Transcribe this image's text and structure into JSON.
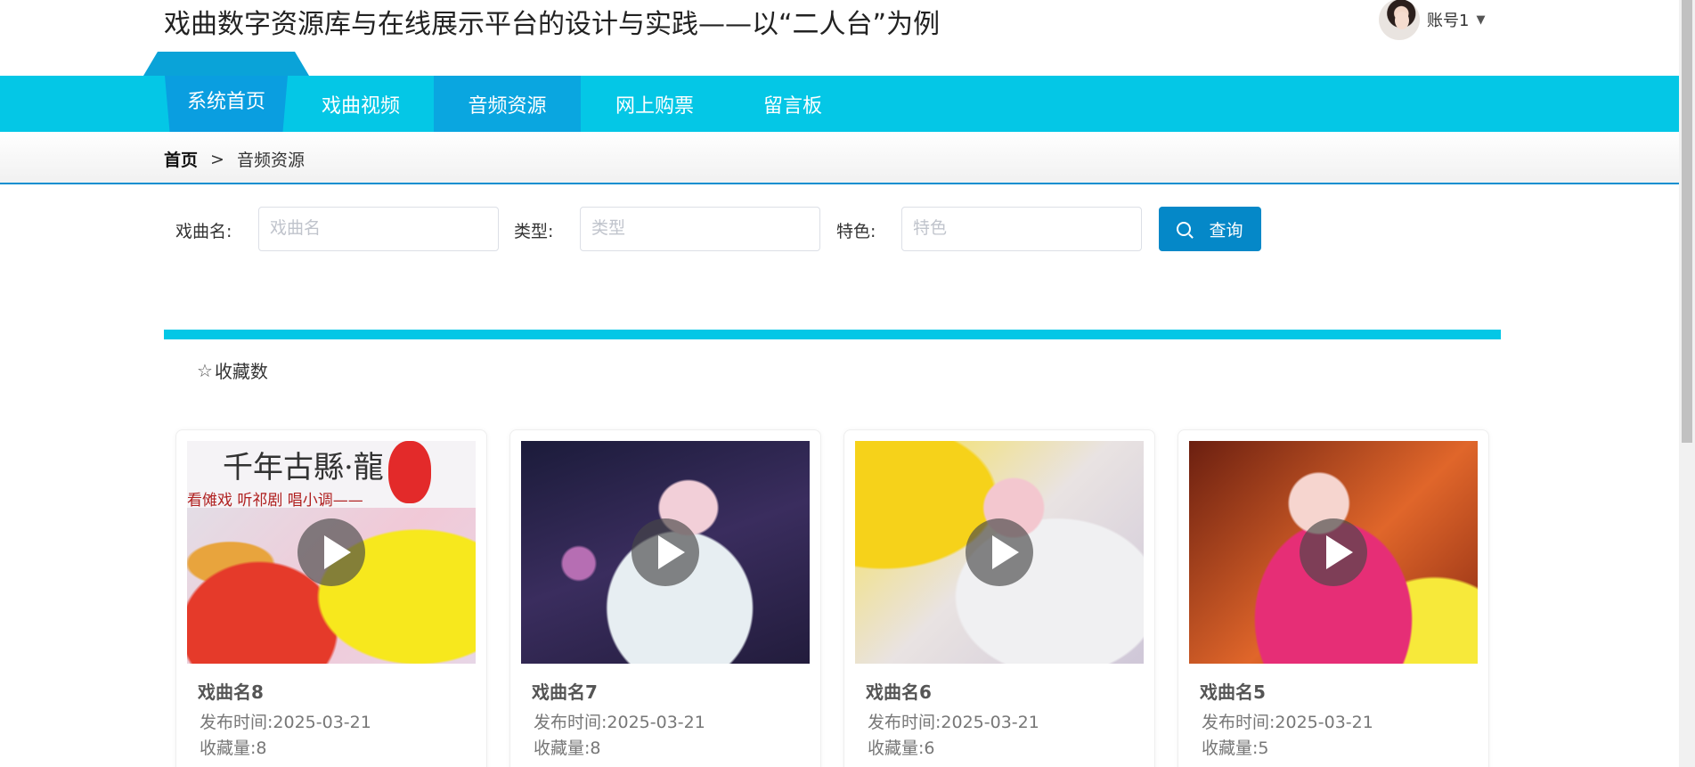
{
  "header": {
    "title": "戏曲数字资源库与在线展示平台的设计与实践——以“二人台”为例",
    "account_name": "账号1"
  },
  "nav": {
    "items": [
      {
        "label": "系统首页"
      },
      {
        "label": "戏曲视频"
      },
      {
        "label": "音频资源"
      },
      {
        "label": "网上购票"
      },
      {
        "label": "留言板"
      }
    ],
    "active": "音频资源"
  },
  "breadcrumb": {
    "home": "首页",
    "separator": ">",
    "current": "音频资源"
  },
  "search": {
    "name_label": "戏曲名:",
    "name_placeholder": "戏曲名",
    "type_label": "类型:",
    "type_placeholder": "类型",
    "feature_label": "特色:",
    "feature_placeholder": "特色",
    "button_label": "查询"
  },
  "sort": {
    "favorites_label": "收藏数"
  },
  "cards": [
    {
      "name": "戏曲名8",
      "publish": "发布时间:2025-03-21",
      "favorites": "收藏量:8"
    },
    {
      "name": "戏曲名7",
      "publish": "发布时间:2025-03-21",
      "favorites": "收藏量:8"
    },
    {
      "name": "戏曲名6",
      "publish": "发布时间:2025-03-21",
      "favorites": "收藏量:6"
    },
    {
      "name": "戏曲名5",
      "publish": "发布时间:2025-03-21",
      "favorites": "收藏量:5"
    }
  ],
  "thumb8_text": {
    "line1": "千年古縣·龍",
    "line2": "看傩戏 听祁剧 唱小调——"
  },
  "colors": {
    "nav": "#04c7e6",
    "nav_active": "#0aa6e0",
    "button": "#0588c8",
    "accent_line": "#0a8fd0"
  }
}
